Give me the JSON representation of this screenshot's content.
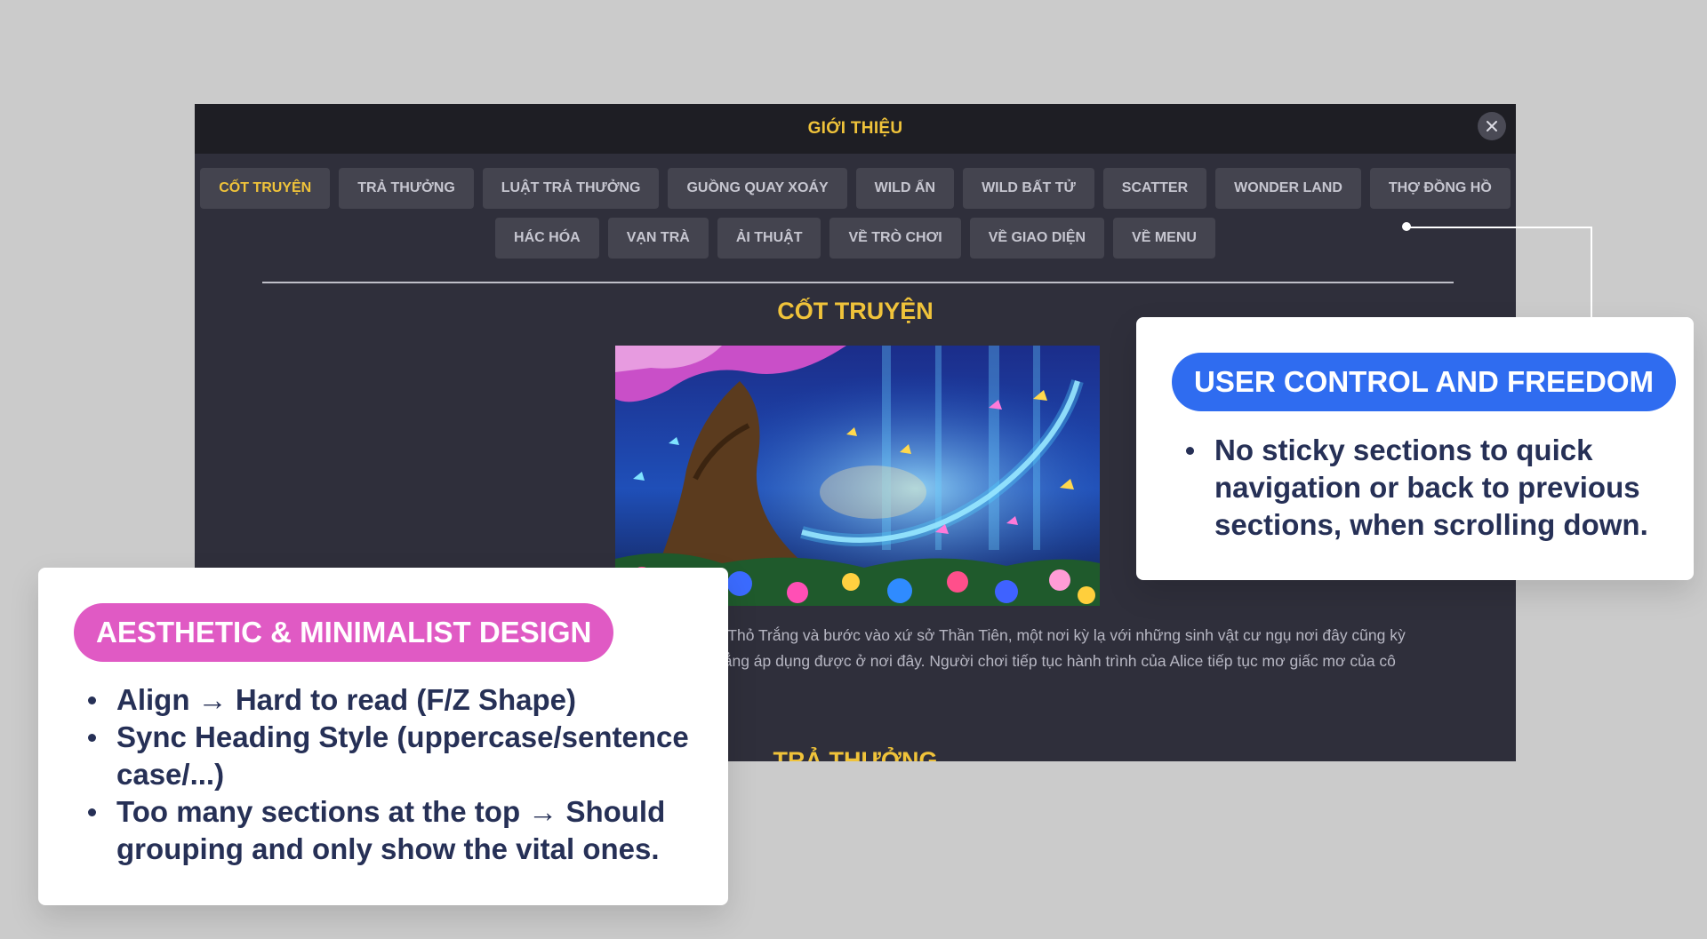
{
  "modal": {
    "title": "GIỚI THIỆU",
    "close_icon": "close-icon",
    "tab_rows": [
      [
        "CỐT TRUYỆN",
        "TRẢ THƯỞNG",
        "LUẬT TRẢ THƯỞNG",
        "GUỒNG QUAY XOÁY",
        "WILD ẨN",
        "WILD BẤT TỬ",
        "SCATTER",
        "WONDER LAND",
        "THỢ ĐỒNG HỒ"
      ],
      [
        "HÁC HÓA",
        "VẠN TRÀ",
        "ẢI THUẬT",
        "VỀ TRÒ CHƠI",
        "VỀ GIAO DIỆN",
        "VỀ MENU"
      ]
    ],
    "active_tab": "CỐT TRUYỆN",
    "section_title": "CỐT TRUYỆN",
    "story_lines": [
      "o Thỏ Trắng và bước vào xứ sở Thần Tiên, một nơi kỳ lạ với những sinh vật cư ngụ nơi đây cũng kỳ",
      "hẳng áp dụng được ở nơi đây. Người chơi tiếp tục hành trình của Alice tiếp tục mơ giấc mơ của cô"
    ],
    "next_section_title": "TRẢ THƯỞNG",
    "colors": {
      "accent": "#f0c33a",
      "header_bg": "#1e1e24",
      "body_bg": "#2f2f3b",
      "tab_bg": "#44444f"
    }
  },
  "annotations": {
    "user_control": {
      "label": "USER CONTROL AND FREEDOM",
      "color": "#2f6cf0",
      "bullets": [
        "No sticky sections to quick navigation or back to previous sections, when scrolling down."
      ]
    },
    "aesthetic": {
      "label": "AESTHETIC & MINIMALIST DESIGN",
      "color": "#e05ac4",
      "bullets": [
        "Align → Hard to read (F/Z Shape)",
        "Sync Heading Style (uppercase/sentence case/...)",
        "Too many sections at the top → Should grouping and only show the vital ones."
      ]
    }
  }
}
